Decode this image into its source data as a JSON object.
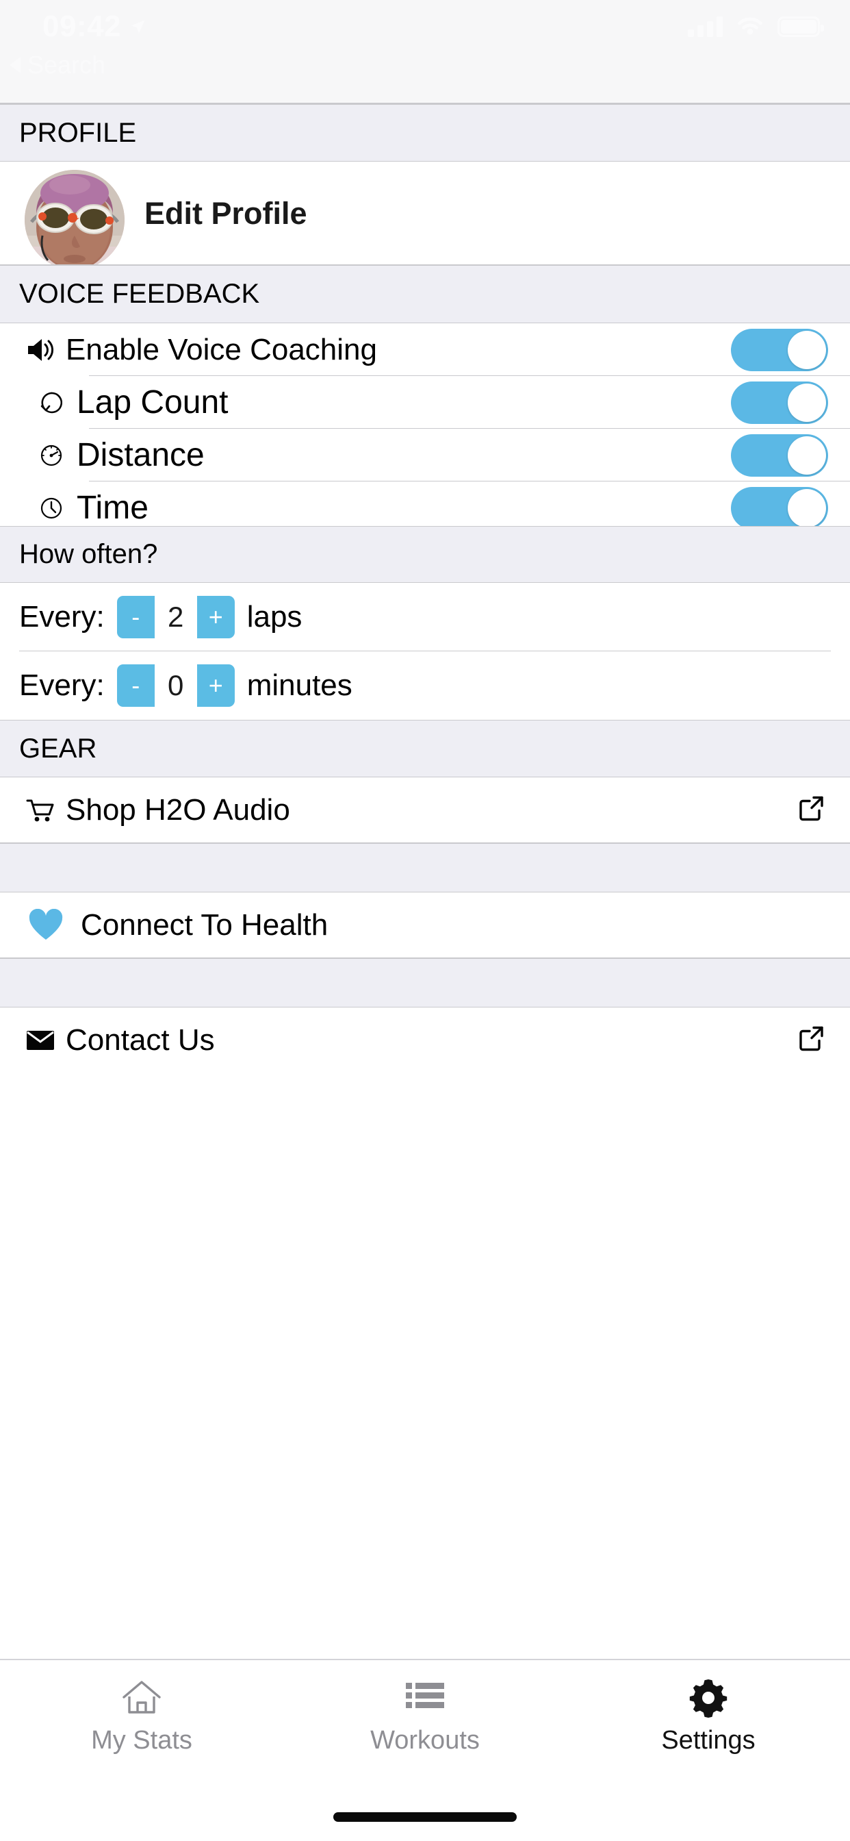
{
  "status_bar": {
    "time": "09:42",
    "back_label": "Search",
    "location_icon": "location-arrow-icon",
    "signal_icon": "cellular-signal-icon",
    "wifi_icon": "wifi-icon",
    "battery_icon": "battery-full-icon"
  },
  "profile": {
    "section_title": "PROFILE",
    "avatar_name": "user-avatar",
    "edit_label": "Edit Profile"
  },
  "voice_feedback": {
    "section_title": "VOICE FEEDBACK",
    "rows": [
      {
        "label": "Enable Voice Coaching",
        "icon": "speaker-volume-icon",
        "toggle_on": true
      },
      {
        "label": "Lap Count",
        "icon": "lap-repeat-icon",
        "toggle_on": true
      },
      {
        "label": "Distance",
        "icon": "speedometer-icon",
        "toggle_on": true
      },
      {
        "label": "Time",
        "icon": "clock-icon",
        "toggle_on": true
      }
    ]
  },
  "how_often": {
    "section_title": "How often?",
    "steppers": [
      {
        "prefix": "Every:",
        "minus": "-",
        "value": "2",
        "plus": "+",
        "unit": "laps"
      },
      {
        "prefix": "Every:",
        "minus": "-",
        "value": "0",
        "plus": "+",
        "unit": "minutes"
      }
    ]
  },
  "gear": {
    "section_title": "GEAR",
    "rows": [
      {
        "label": "Shop H2O Audio",
        "icon": "shopping-cart-icon",
        "trailing_icon": "external-link-icon"
      }
    ]
  },
  "health": {
    "rows": [
      {
        "label": "Connect To Health",
        "icon": "heart-icon"
      }
    ]
  },
  "contact": {
    "rows": [
      {
        "label": "Contact Us",
        "icon": "envelope-icon",
        "trailing_icon": "external-link-icon"
      }
    ]
  },
  "tab_bar": {
    "tabs": [
      {
        "label": "My Stats",
        "icon": "home-icon",
        "active": false
      },
      {
        "label": "Workouts",
        "icon": "list-icon",
        "active": false
      },
      {
        "label": "Settings",
        "icon": "gear-icon",
        "active": true
      }
    ]
  },
  "colors": {
    "toggle_on": "#5bb8e5",
    "stepper_button": "#5bbce4",
    "heart": "#5bb8e5",
    "section_bg": "#eeeef4",
    "tab_inactive": "#8e8e93",
    "tab_active": "#121212"
  }
}
